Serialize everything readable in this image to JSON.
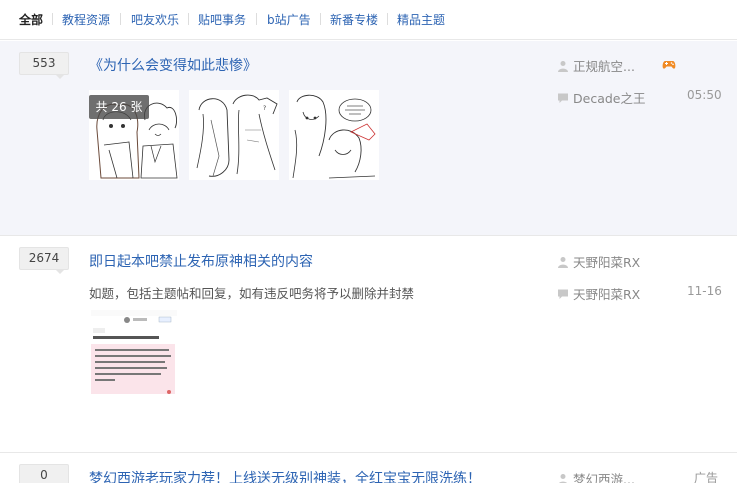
{
  "tabs": [
    {
      "label": "全部",
      "active": true
    },
    {
      "label": "教程资源",
      "active": false
    },
    {
      "label": "吧友欢乐",
      "active": false
    },
    {
      "label": "贴吧事务",
      "active": false
    },
    {
      "label": "b站广告",
      "active": false
    },
    {
      "label": "新番专楼",
      "active": false
    },
    {
      "label": "精品主题",
      "active": false
    }
  ],
  "threads": [
    {
      "reply_count": "553",
      "title": "《为什么会变得如此悲惨》",
      "author": "正规航空...",
      "last_replier": "Decade之王",
      "last_time": "05:50",
      "image_count_label": "共 26 张",
      "author_icon": "game-controller-icon"
    },
    {
      "reply_count": "2674",
      "title": "即日起本吧禁止发布原神相关的内容",
      "abstract": "如题，包括主题帖和回复，如有违反吧务将予以删除并封禁",
      "author": "天野阳菜RX",
      "last_replier": "天野阳菜RX",
      "last_time": "11-16",
      "screenshot_title": "原神禁止发布（官方公告，一次性删帖）"
    },
    {
      "reply_count": "0",
      "title": "梦幻西游老玩家力荐！上线送无级别神装，全红宝宝无限洗练！",
      "author": "梦幻西游...",
      "last_time": "广告"
    }
  ],
  "colors": {
    "link": "#2d64b3",
    "highlight_bg": "#f4f5fa",
    "divider": "#e8e8e8",
    "muted": "#888888"
  }
}
